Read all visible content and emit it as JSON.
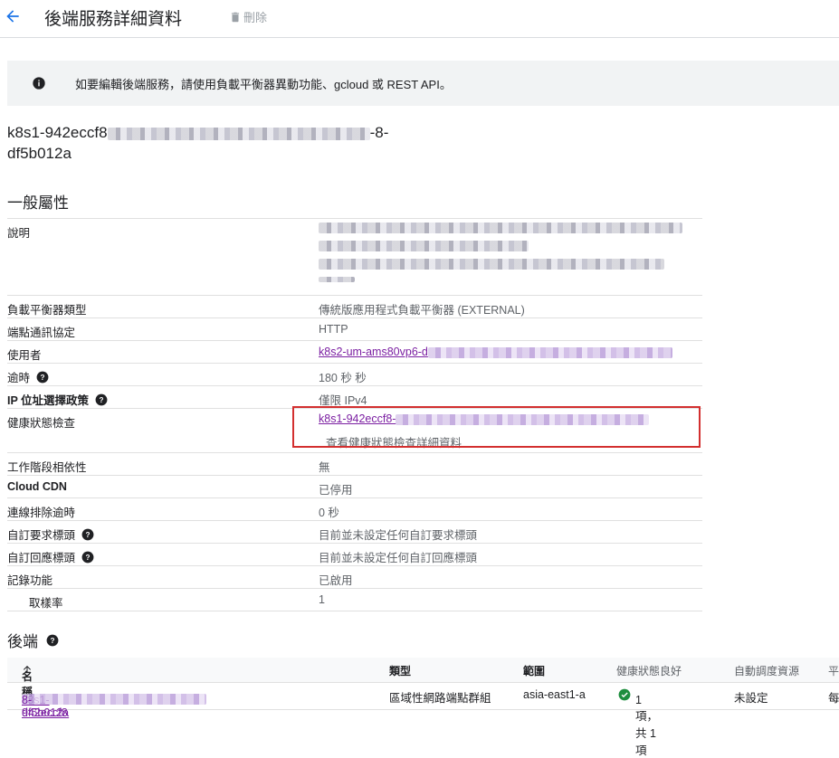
{
  "header": {
    "title": "後端服務詳細資料",
    "delete_label": "刪除"
  },
  "banner": {
    "text": "如要編輯後端服務，請使用負載平衡器異動功能、gcloud 或 REST API。"
  },
  "service": {
    "name_prefix": "k8s1-942eccf8",
    "name_suffix": "-8-",
    "name_line2": "df5b012a"
  },
  "general": {
    "title": "一般屬性",
    "rows": [
      {
        "label": "說明",
        "value": ""
      },
      {
        "label": "負載平衡器類型",
        "value": "傳統版應用程式負載平衡器 (EXTERNAL)"
      },
      {
        "label": "端點通訊協定",
        "value": "HTTP"
      },
      {
        "label": "使用者",
        "value": "k8s2-um-ams80vp6-d"
      },
      {
        "label": "逾時",
        "value": "180 秒 秒"
      },
      {
        "label": "IP 位址選擇政策",
        "value": "僅限 IPv4"
      },
      {
        "label": "健康狀態檢查",
        "value": "k8s1-942eccf8-",
        "link2": "查看健康狀態檢查詳細資料"
      },
      {
        "label": "工作階段相依性",
        "value": "無"
      },
      {
        "label": "Cloud CDN",
        "value": "已停用"
      },
      {
        "label": "連線排除逾時",
        "value": "0 秒"
      },
      {
        "label": "自訂要求標頭",
        "value": "目前並未設定任何自訂要求標頭"
      },
      {
        "label": "自訂回應標頭",
        "value": "目前並未設定任何自訂回應標頭"
      },
      {
        "label": "記錄功能",
        "value": "已啟用"
      },
      {
        "label": "取樣率",
        "value": "1"
      }
    ]
  },
  "backends": {
    "title": "後端",
    "columns": [
      "名稱",
      "類型",
      "範圍",
      "健康狀態良好",
      "自動調度資源",
      "平"
    ],
    "rows": [
      {
        "name_prefix": "k8s1-942eccf8",
        "name_suffix": "8-df5b012a",
        "type": "區域性網路端點群組",
        "scope": "asia-east1-a",
        "health": "1 項，共 1 項",
        "autoscale": "未設定",
        "extra": "每"
      }
    ]
  },
  "colors": {
    "accent": "#1a73e8",
    "link_visited": "#7b1fa2",
    "highlight": "#d32f2f",
    "ok": "#1e8e3e"
  }
}
